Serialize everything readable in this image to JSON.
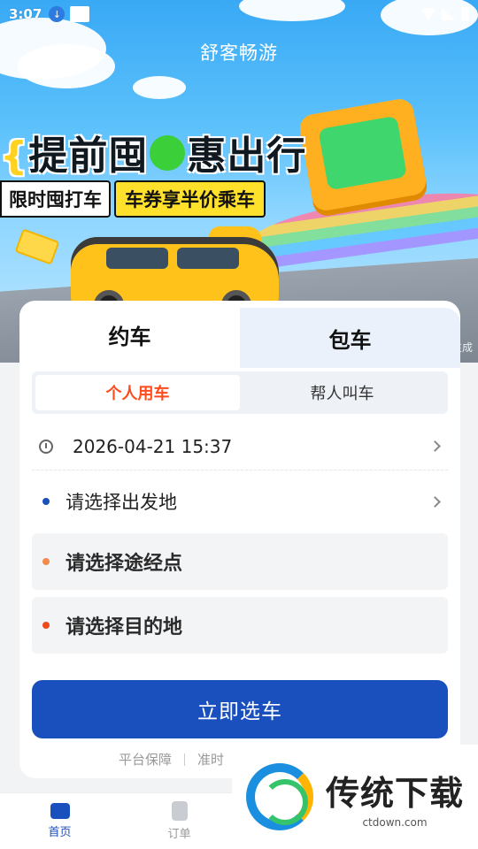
{
  "status_bar": {
    "time": "3:07"
  },
  "banner": {
    "app_title": "舒客畅游",
    "headline_open": "{",
    "headline_part1": "提前囤",
    "headline_part2": "惠出行",
    "tag_left": "限时囤打车",
    "tag_right": "车券享半价乘车",
    "ai_note": "豆包AI生成"
  },
  "tabs": {
    "active": "约车",
    "inactive": "包车"
  },
  "segment": {
    "active": "个人用车",
    "inactive": "帮人叫车"
  },
  "trip": {
    "datetime": "2026-04-21 15:37",
    "start_placeholder": "请选择出发地",
    "via_placeholder": "请选择途经点",
    "destination_placeholder": "请选择目的地"
  },
  "cta": {
    "label": "立即选车"
  },
  "footer": {
    "link1": "平台保障",
    "link2": "准时"
  },
  "bottom_nav": [
    {
      "label": "首页",
      "icon": "car-icon",
      "active": true
    },
    {
      "label": "订单",
      "icon": "order-icon",
      "active": false
    }
  ],
  "watermark": {
    "title": "传统下载",
    "url": "ctdown.com"
  },
  "colors": {
    "primary": "#1a4fbe",
    "accent_orange": "#ff4a1c",
    "dot_start": "#1a4fbe",
    "dot_via": "#f28a4c",
    "dot_destination": "#f04a1c"
  }
}
